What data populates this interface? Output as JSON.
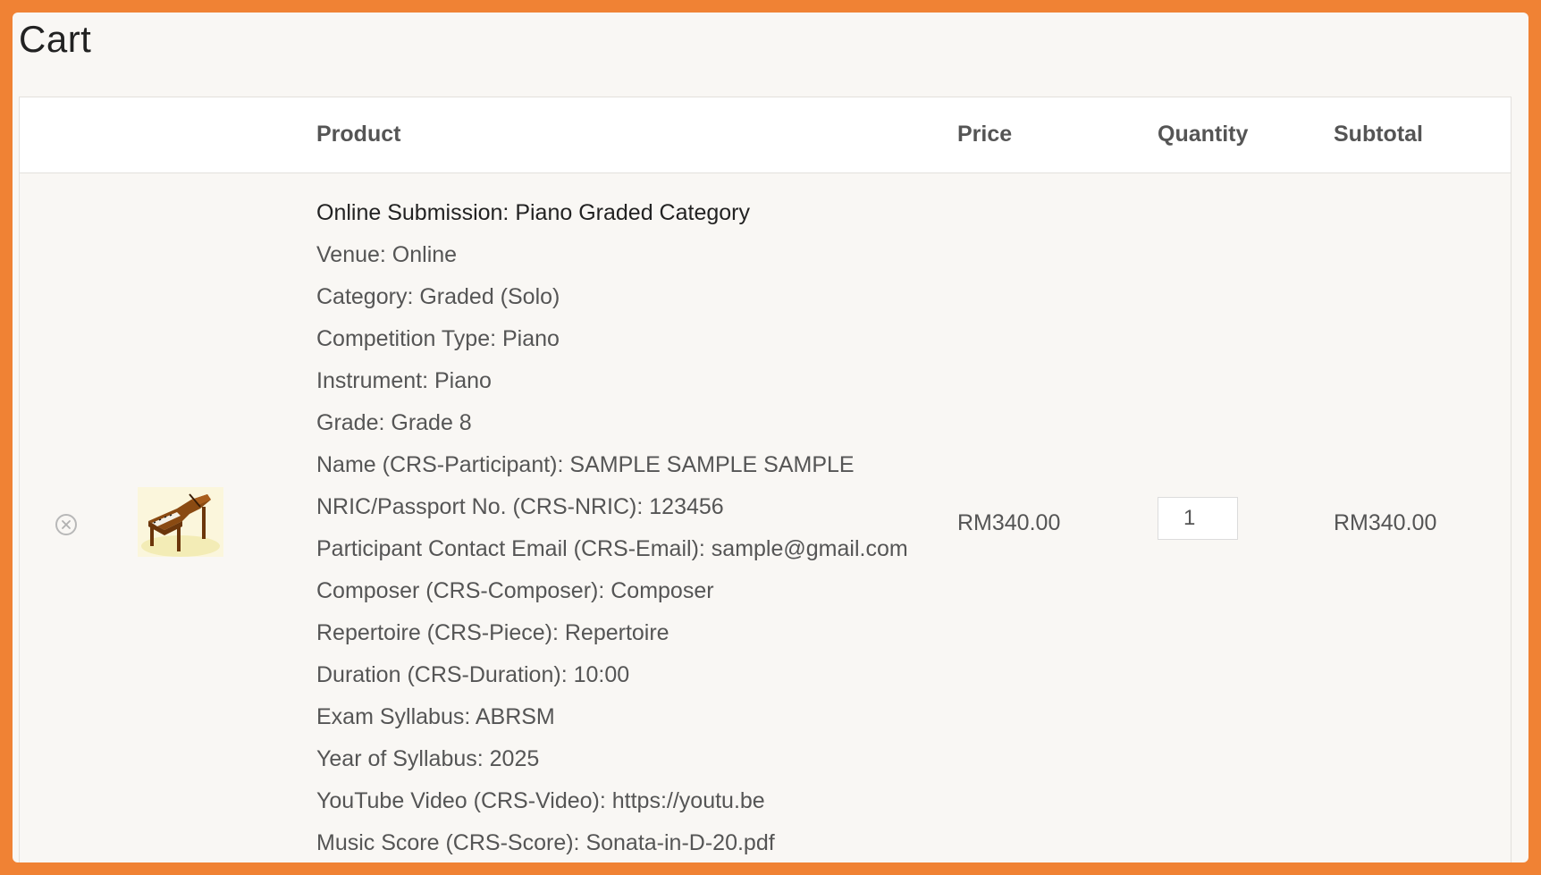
{
  "page": {
    "title": "Cart"
  },
  "table": {
    "headers": {
      "product": "Product",
      "price": "Price",
      "quantity": "Quantity",
      "subtotal": "Subtotal"
    }
  },
  "item": {
    "name": "Online Submission: Piano Graded Category",
    "meta": [
      "Venue: Online",
      "Category: Graded (Solo)",
      "Competition Type: Piano",
      "Instrument: Piano",
      "Grade: Grade 8",
      "Name (CRS-Participant): SAMPLE SAMPLE SAMPLE",
      "NRIC/Passport No. (CRS-NRIC): 123456",
      "Participant Contact Email (CRS-Email): sample@gmail.com",
      "Composer (CRS-Composer): Composer",
      "Repertoire (CRS-Piece): Repertoire",
      "Duration (CRS-Duration): 10:00",
      "Exam Syllabus: ABRSM",
      "Year of Syllabus: 2025",
      "YouTube Video (CRS-Video): https://youtu.be",
      "Music Score (CRS-Score): Sonata-in-D-20.pdf"
    ],
    "price": "RM340.00",
    "quantity": "1",
    "subtotal": "RM340.00",
    "remove_icon": "close-circle-icon",
    "thumbnail_icon": "grand-piano-icon"
  },
  "colors": {
    "frame": "#f08234",
    "background": "#f9f7f4",
    "header_bg": "#ffffff",
    "text_dark": "#222222",
    "text_muted": "#555555"
  }
}
